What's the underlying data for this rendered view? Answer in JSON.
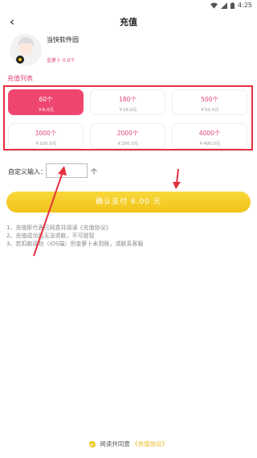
{
  "status": {
    "time": "4:25"
  },
  "header": {
    "back_icon": "back-arrow-icon",
    "title": "充值"
  },
  "user": {
    "name": "当快软件园",
    "balance": "金萝卜 0.0个"
  },
  "section": {
    "label": "充值列表"
  },
  "options": [
    {
      "amount": "60个",
      "price": "￥6.0元",
      "selected": true
    },
    {
      "amount": "180个",
      "price": "￥18.0元",
      "selected": false
    },
    {
      "amount": "500个",
      "price": "￥50.0元",
      "selected": false
    },
    {
      "amount": "1000个",
      "price": "￥100.0元",
      "selected": false
    },
    {
      "amount": "2000个",
      "price": "￥200.0元",
      "selected": false
    },
    {
      "amount": "4000个",
      "price": "￥400.0元",
      "selected": false
    }
  ],
  "custom": {
    "label": "自定义输入：",
    "value": "",
    "unit": "个"
  },
  "pay_button": {
    "label": "确认支付 6.00 元"
  },
  "notes": [
    "1、充值即代表已同意并阅读《充值协议》",
    "2、充值成功后无法退款，不可提现",
    "3、若扣款成功（iOS端）但金萝卜未到账，请联系客服"
  ],
  "agreement": {
    "prefix": "阅读并同意",
    "link": "《充值协议》"
  },
  "colors": {
    "accent": "#ef4670",
    "pay": "#f2c31a",
    "annotation": "#e5303e"
  }
}
